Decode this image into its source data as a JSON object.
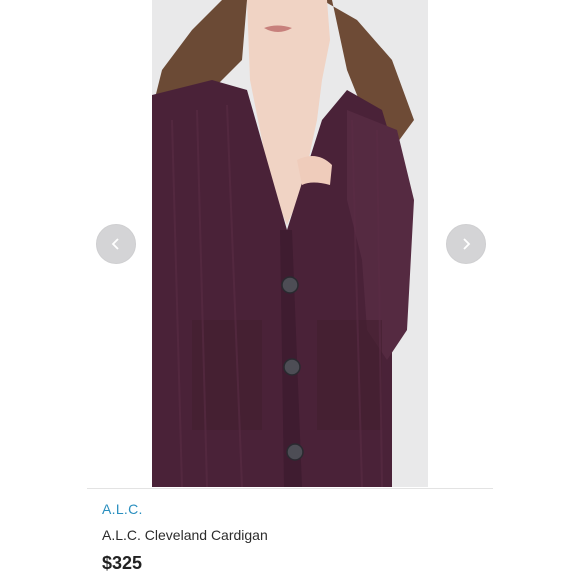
{
  "product": {
    "brand": "A.L.C.",
    "title": "A.L.C. Cleveland Cardigan",
    "price": "$325"
  },
  "carousel": {
    "prev_icon": "chevron-left-icon",
    "next_icon": "chevron-right-icon"
  },
  "colors": {
    "brand_link": "#2a8fbf",
    "sweater": "#4a2238",
    "background": "#e9e9ea"
  }
}
